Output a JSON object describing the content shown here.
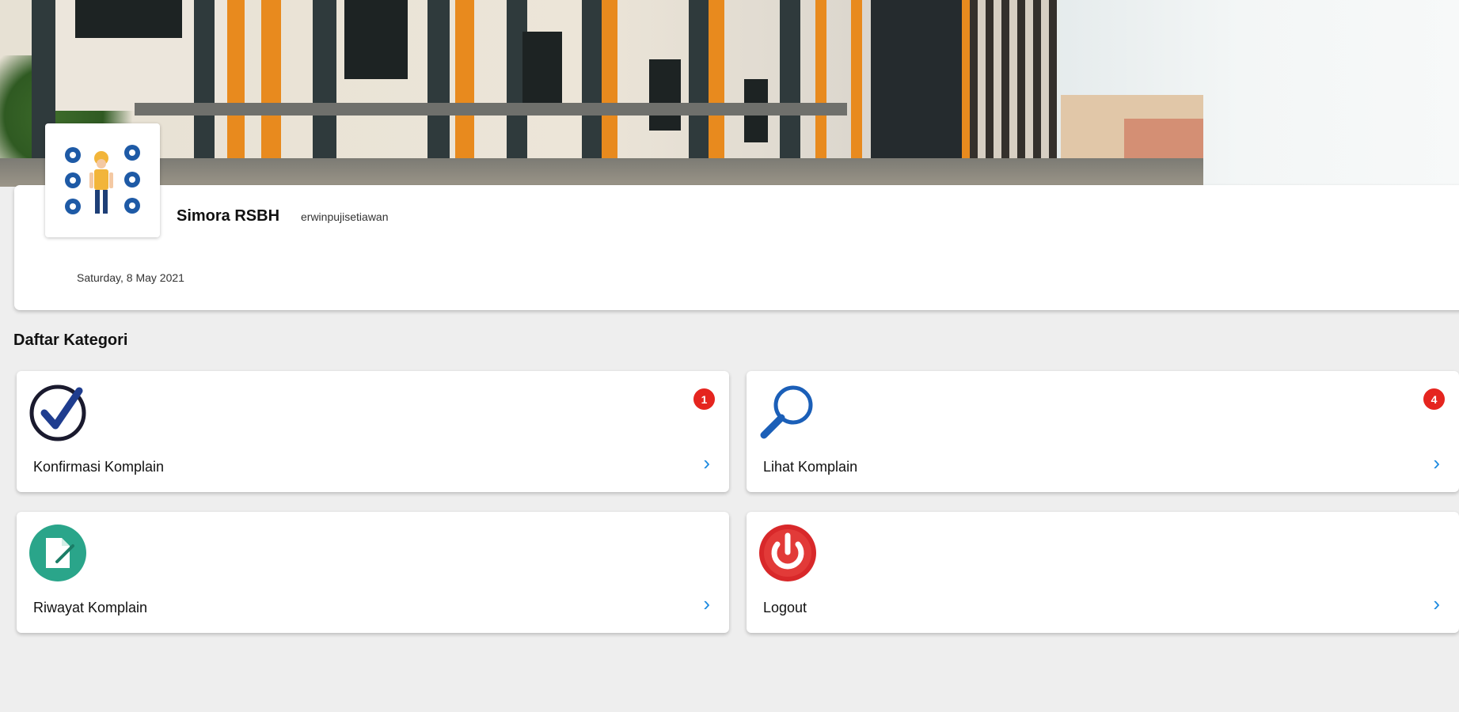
{
  "profile": {
    "app_name": "Simora RSBH",
    "username": "erwinpujisetiawan",
    "date": "Saturday, 8 May 2021"
  },
  "section_title": "Daftar Kategori",
  "categories": [
    {
      "label": "Konfirmasi Komplain",
      "icon": "checkmark-circle-icon",
      "badge": "1"
    },
    {
      "label": "Lihat Komplain",
      "icon": "magnifier-icon",
      "badge": "4"
    },
    {
      "label": "Riwayat Komplain",
      "icon": "document-edit-icon",
      "badge": ""
    },
    {
      "label": "Logout",
      "icon": "power-icon",
      "badge": ""
    }
  ],
  "colors": {
    "background": "#eeeeee",
    "badge": "#e5251f",
    "chevron": "#1e8be0",
    "check_icon": "#1f3d8f",
    "search_icon": "#1b5fb8",
    "history_icon": "#2aa58a",
    "logout_icon": "#d8282a"
  }
}
